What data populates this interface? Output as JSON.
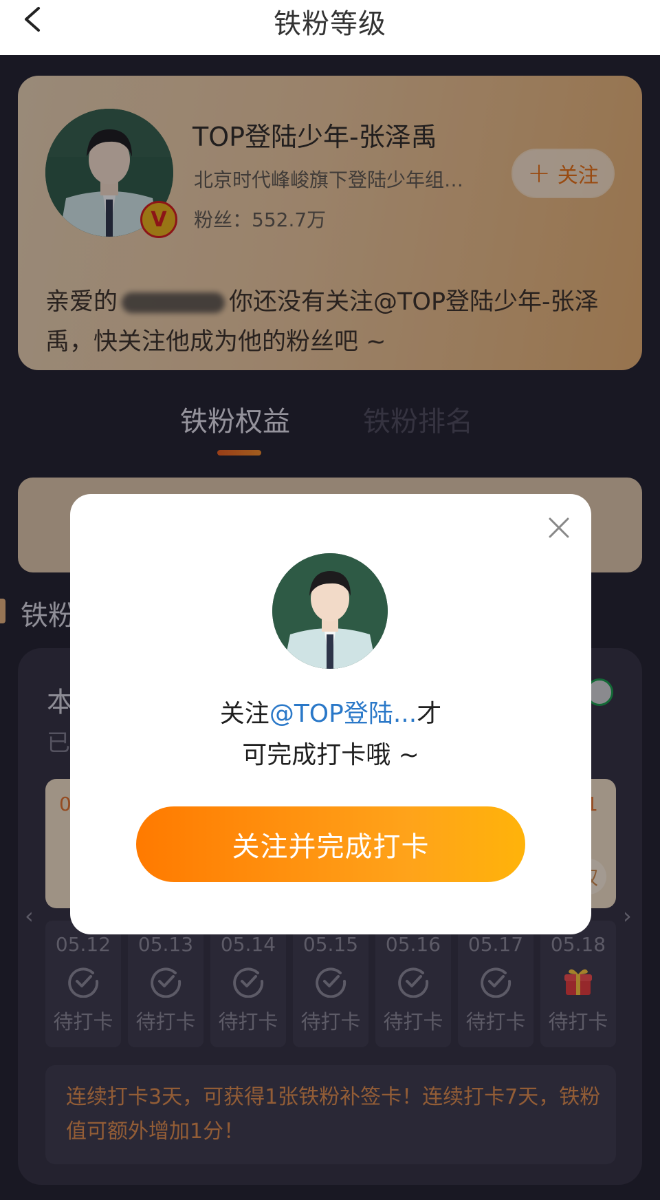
{
  "header": {
    "title": "铁粉等级"
  },
  "profile": {
    "name": "TOP登陆少年-张泽禹",
    "description": "北京时代峰峻旗下登陆少年组…",
    "fans_label": "粉丝：552.7万",
    "follow_label": "关注",
    "notice_prefix": "亲爱的",
    "notice_suffix": "你还没有关注@TOP登陆少年-张泽禹，快关注他成为他的粉丝吧 ~"
  },
  "tabs": [
    {
      "label": "铁粉权益"
    },
    {
      "label": "铁粉排名"
    }
  ],
  "section": {
    "title": "铁粉"
  },
  "panel": {
    "line1": "本",
    "line2": "已"
  },
  "gift_card": {
    "left_text": "0",
    "right_text": "1",
    "button_text": "权"
  },
  "checkin": {
    "days": [
      {
        "date": "05.12",
        "label": "待打卡",
        "icon": "check-circle-icon"
      },
      {
        "date": "05.13",
        "label": "待打卡",
        "icon": "check-circle-icon"
      },
      {
        "date": "05.14",
        "label": "待打卡",
        "icon": "check-circle-icon"
      },
      {
        "date": "05.15",
        "label": "待打卡",
        "icon": "check-circle-icon"
      },
      {
        "date": "05.16",
        "label": "待打卡",
        "icon": "check-circle-icon"
      },
      {
        "date": "05.17",
        "label": "待打卡",
        "icon": "check-circle-icon"
      },
      {
        "date": "05.18",
        "label": "待打卡",
        "icon": "gift-icon"
      }
    ],
    "tips": "连续打卡3天，可获得1张铁粉补签卡！连续打卡7天，铁粉值可额外增加1分！"
  },
  "modal": {
    "text_prefix": "关注",
    "mention": "@TOP登陆...",
    "text_suffix": "才",
    "line2": "可完成打卡哦 ~",
    "button": "关注并完成打卡"
  },
  "colors": {
    "accent": "#ff8a00",
    "mention": "#2a78c8",
    "bg": "#23212d"
  }
}
